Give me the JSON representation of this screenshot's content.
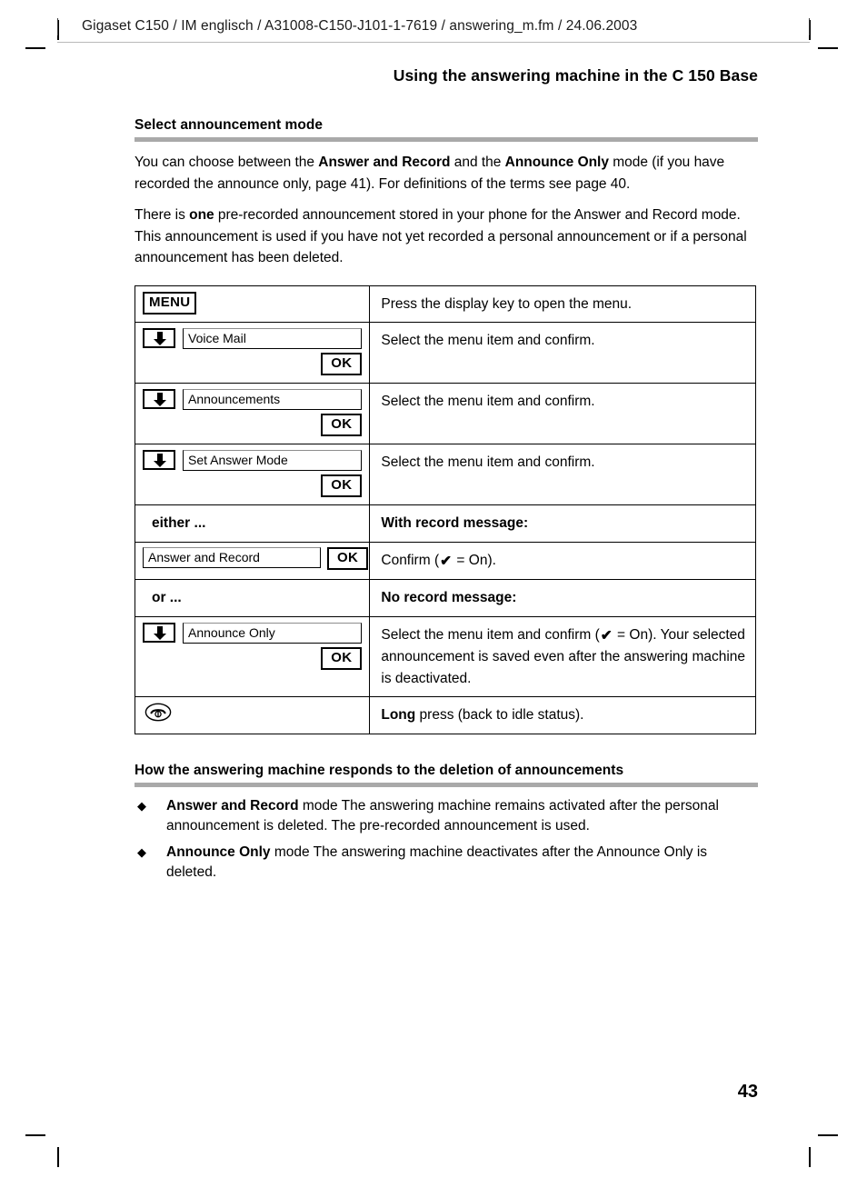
{
  "running_header": {
    "text": "Gigaset C150 / IM englisch / A31008-C150-J101-1-7619 / answering_m.fm / 24.06.2003"
  },
  "chapter_title": "Using the answering machine in the C 150 Base",
  "sections": [
    {
      "heading": "Select announcement mode",
      "paragraphs": [
        {
          "runs": [
            {
              "text": "You can choose between the ",
              "bold": false
            },
            {
              "text": "Answer and Record",
              "bold": true
            },
            {
              "text": " and the ",
              "bold": false
            },
            {
              "text": "Announce Only",
              "bold": true
            },
            {
              "text": " mode (if you have recorded the announce only, page 41). For definitions of the terms see page 40.",
              "bold": false
            }
          ]
        },
        {
          "runs": [
            {
              "text": "There is ",
              "bold": false
            },
            {
              "text": "one",
              "bold": true
            },
            {
              "text": " pre-recorded announcement stored in your phone for the Answer and Record mode. This announcement is used if you have not yet recorded a personal announcement or if a personal announcement has been deleted.",
              "bold": false
            }
          ]
        }
      ]
    }
  ],
  "procedure_table": {
    "rows": [
      {
        "id": "menu",
        "left": {
          "type": "softkey",
          "softkey_label": "MENU"
        },
        "right": {
          "text": "Press the display key to open the menu.",
          "bold_prefix": ""
        }
      },
      {
        "id": "voice-mail",
        "left": {
          "type": "arrow-display-ok",
          "display_text": "Voice Mail",
          "ok_label": "OK"
        },
        "right": {
          "text": "Select the menu item and confirm.",
          "bold_prefix": ""
        }
      },
      {
        "id": "announcements",
        "left": {
          "type": "arrow-display-ok",
          "display_text": "Announcements",
          "ok_label": "OK"
        },
        "right": {
          "text": "Select the menu item and confirm.",
          "bold_prefix": ""
        }
      },
      {
        "id": "set-answer-mode",
        "left": {
          "type": "arrow-display-ok",
          "display_text": "Set Answer Mode",
          "ok_label": "OK"
        },
        "right": {
          "text": "Select the menu item and confirm.",
          "bold_prefix": ""
        }
      },
      {
        "id": "either",
        "left": {
          "type": "label",
          "label": "either ..."
        },
        "right": {
          "text": "With record message:",
          "bold_all": true
        }
      },
      {
        "id": "answer-and-record",
        "left": {
          "type": "display-ok-inline",
          "display_text": "Answer and Record",
          "ok_label": "OK"
        },
        "right": {
          "text_before": "Confirm (",
          "check": "✔",
          "text_after": " = On)."
        }
      },
      {
        "id": "or",
        "left": {
          "type": "label",
          "label": "or ..."
        },
        "right": {
          "text": "No record message:",
          "bold_all": true
        }
      },
      {
        "id": "announce-only",
        "left": {
          "type": "arrow-display-ok",
          "display_text": "Announce Only",
          "ok_label": "OK"
        },
        "right": {
          "text_before": "Select the menu item and confirm (",
          "check": "✔",
          "text_after": " = On). Your selected announcement is saved even after the answering machine is deactivated."
        }
      },
      {
        "id": "end-call",
        "left": {
          "type": "endkey",
          "icon": "end-call-icon"
        },
        "right": {
          "bold_prefix": "Long",
          "text": " press (back to idle status)."
        }
      }
    ]
  },
  "bottom_section": {
    "heading": "How the answering machine responds to the deletion of announcements",
    "bullet_mark": "◆",
    "bullets": [
      {
        "runs": [
          {
            "text": "Answer and Record",
            "bold": true
          },
          {
            "text": " mode The answering machine remains activated after the personal announcement is deleted. The pre-recorded announcement is used.",
            "bold": false
          }
        ]
      },
      {
        "runs": [
          {
            "text": "Announce Only",
            "bold": true
          },
          {
            "text": " mode The answering machine deactivates after the Announce Only is deleted.",
            "bold": false
          }
        ]
      }
    ]
  },
  "page_number": "43",
  "colors": {
    "rule_gray": "#a9a9a9",
    "header_rule": "#b9b9b9",
    "text": "#000000"
  }
}
